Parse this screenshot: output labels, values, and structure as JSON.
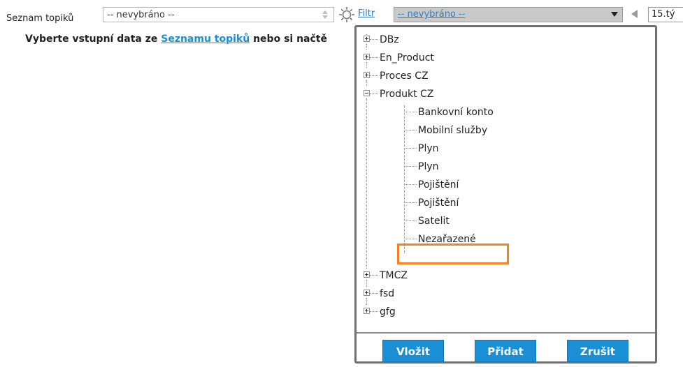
{
  "toolbar": {
    "topic_list_label": "Seznam topiků",
    "topic_select_value": "-- nevybráno --",
    "filter_label": "Filtr",
    "filter_select_value": "-- nevybráno --",
    "week_value": "15.tý"
  },
  "info": {
    "prefix": "Vyberte vstupní data ze ",
    "link": "Seznamu topiků",
    "suffix": " nebo si načtě"
  },
  "tree": {
    "items": [
      {
        "label": "DBz",
        "level": 0,
        "state": "collapsed"
      },
      {
        "label": "En_Product",
        "level": 0,
        "state": "collapsed"
      },
      {
        "label": "Proces CZ",
        "level": 0,
        "state": "collapsed"
      },
      {
        "label": "Produkt CZ",
        "level": 0,
        "state": "expanded"
      },
      {
        "label": "Bankovní konto",
        "level": 1
      },
      {
        "label": "Mobilní služby",
        "level": 1
      },
      {
        "label": "Plyn",
        "level": 1
      },
      {
        "label": "Plyn",
        "level": 1
      },
      {
        "label": "Pojištění",
        "level": 1
      },
      {
        "label": "Pojištění",
        "level": 1
      },
      {
        "label": "Satelit",
        "level": 1
      },
      {
        "label": "Nezařazené",
        "level": 1,
        "highlighted": true
      },
      {
        "label": "TMCZ",
        "level": 0,
        "state": "collapsed"
      },
      {
        "label": "fsd",
        "level": 0,
        "state": "collapsed"
      },
      {
        "label": "gfg",
        "level": 0,
        "state": "collapsed"
      }
    ]
  },
  "buttons": {
    "insert": "Vložit",
    "add": "Přidat",
    "cancel": "Zrušit"
  },
  "colors": {
    "accent": "#1a8fd6",
    "highlight": "#f58220",
    "link": "#2a7fc7"
  }
}
